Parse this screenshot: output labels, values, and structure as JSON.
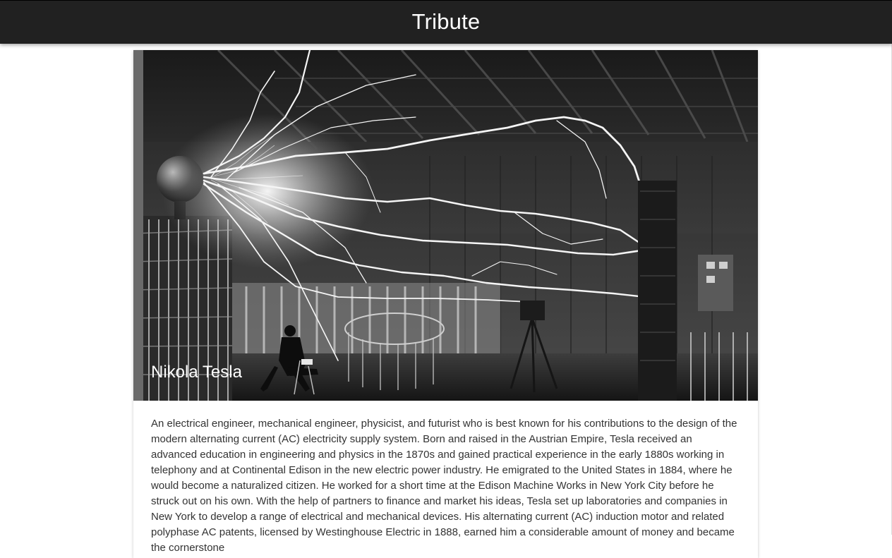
{
  "navbar": {
    "brand": "Tribute",
    "background": "#212121"
  },
  "card": {
    "image": {
      "subject": "Nikola Tesla"
    },
    "title": "Nikola Tesla",
    "description": "An electrical engineer, mechanical engineer, physicist, and futurist who is best known for his contributions to the design of the modern alternating current (AC) electricity supply system. Born and raised in the Austrian Empire, Tesla received an advanced education in engineering and physics in the 1870s and gained practical experience in the early 1880s working in telephony and at Continental Edison in the new electric power industry. He emigrated to the United States in 1884, where he would become a naturalized citizen. He worked for a short time at the Edison Machine Works in New York City before he struck out on his own. With the help of partners to finance and market his ideas, Tesla set up laboratories and companies in New York to develop a range of electrical and mechanical devices. His alternating current (AC) induction motor and related polyphase AC patents, licensed by Westinghouse Electric in 1888, earned him a considerable amount of money and became the cornerstone"
  }
}
